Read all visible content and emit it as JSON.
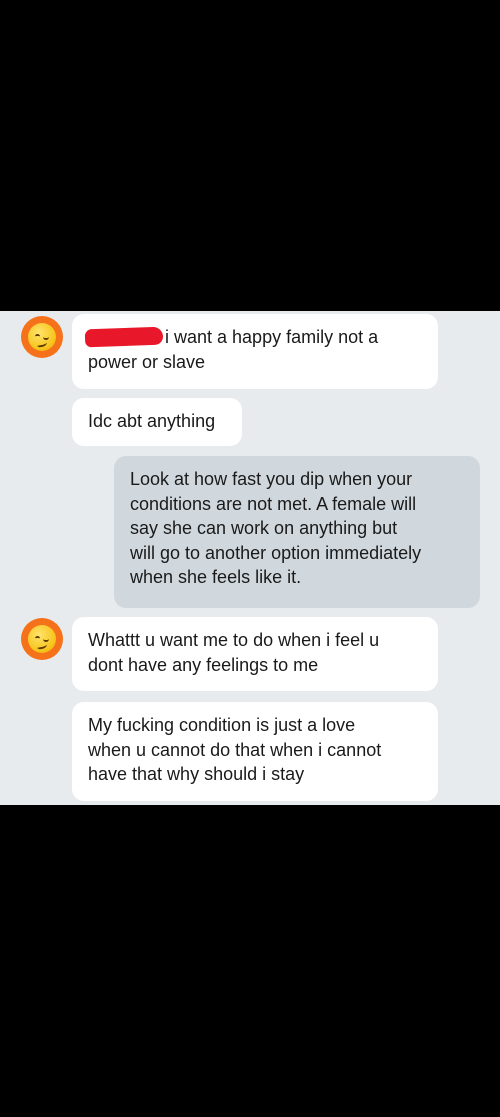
{
  "messages": [
    {
      "direction": "incoming",
      "lines": [
        "i want a happy family  not a",
        "power or slave"
      ],
      "first_line_redacted_prefix": true
    },
    {
      "direction": "incoming",
      "lines": [
        "Idc abt anything"
      ]
    },
    {
      "direction": "outgoing",
      "lines": [
        "Look at how fast you dip when your",
        "conditions are not met. A female will",
        "say she can work on anything but",
        "will go to another option immediately",
        "when she feels like it."
      ]
    },
    {
      "direction": "incoming",
      "lines": [
        "Whattt u want me to do when i feel u",
        "dont have any feelings to me"
      ]
    },
    {
      "direction": "incoming",
      "lines": [
        "My fucking condition is just a love",
        "when u cannot do that when i cannot",
        "have that why should i stay"
      ]
    }
  ],
  "colors": {
    "chat_background": "#e8ebee",
    "incoming_bubble": "#ffffff",
    "outgoing_bubble": "#d0d8de",
    "avatar_ring": "#f5721b",
    "redaction": "#e8182a"
  },
  "avatar_icon": "emoji-smirk-icon"
}
